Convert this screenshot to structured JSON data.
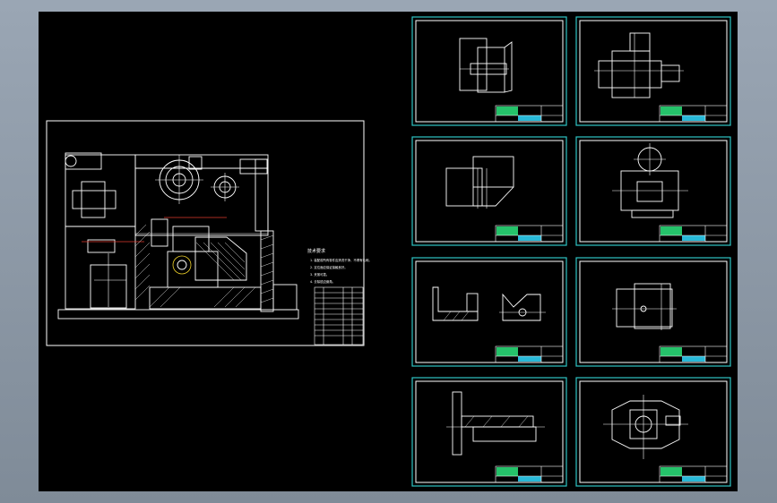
{
  "window": {
    "title": "",
    "background": "#000000",
    "frame_color": "#8b97a5"
  },
  "sheets": [
    {
      "name": "assembly"
    },
    {
      "name": "part-1"
    },
    {
      "name": "part-2"
    },
    {
      "name": "part-3"
    },
    {
      "name": "part-4"
    },
    {
      "name": "part-5"
    },
    {
      "name": "part-6"
    },
    {
      "name": "part-7"
    },
    {
      "name": "part-8"
    }
  ],
  "assembly": {
    "notes_heading": "技术要求",
    "notes": [
      "1. 装配前所有零件应清洗干净，不得有毛刺。",
      "2. 定位面应保证接触良好。",
      "3. 夹紧可靠。",
      "4. 去除锐边倒角。"
    ]
  },
  "colors": {
    "sheet_border": "#2ec4c4",
    "line": "#ffffff",
    "title_block_green": "#25c26a",
    "title_block_cyan": "#28b9d8",
    "accent_red": "#e23b2e",
    "accent_yellow": "#f2d42a"
  }
}
